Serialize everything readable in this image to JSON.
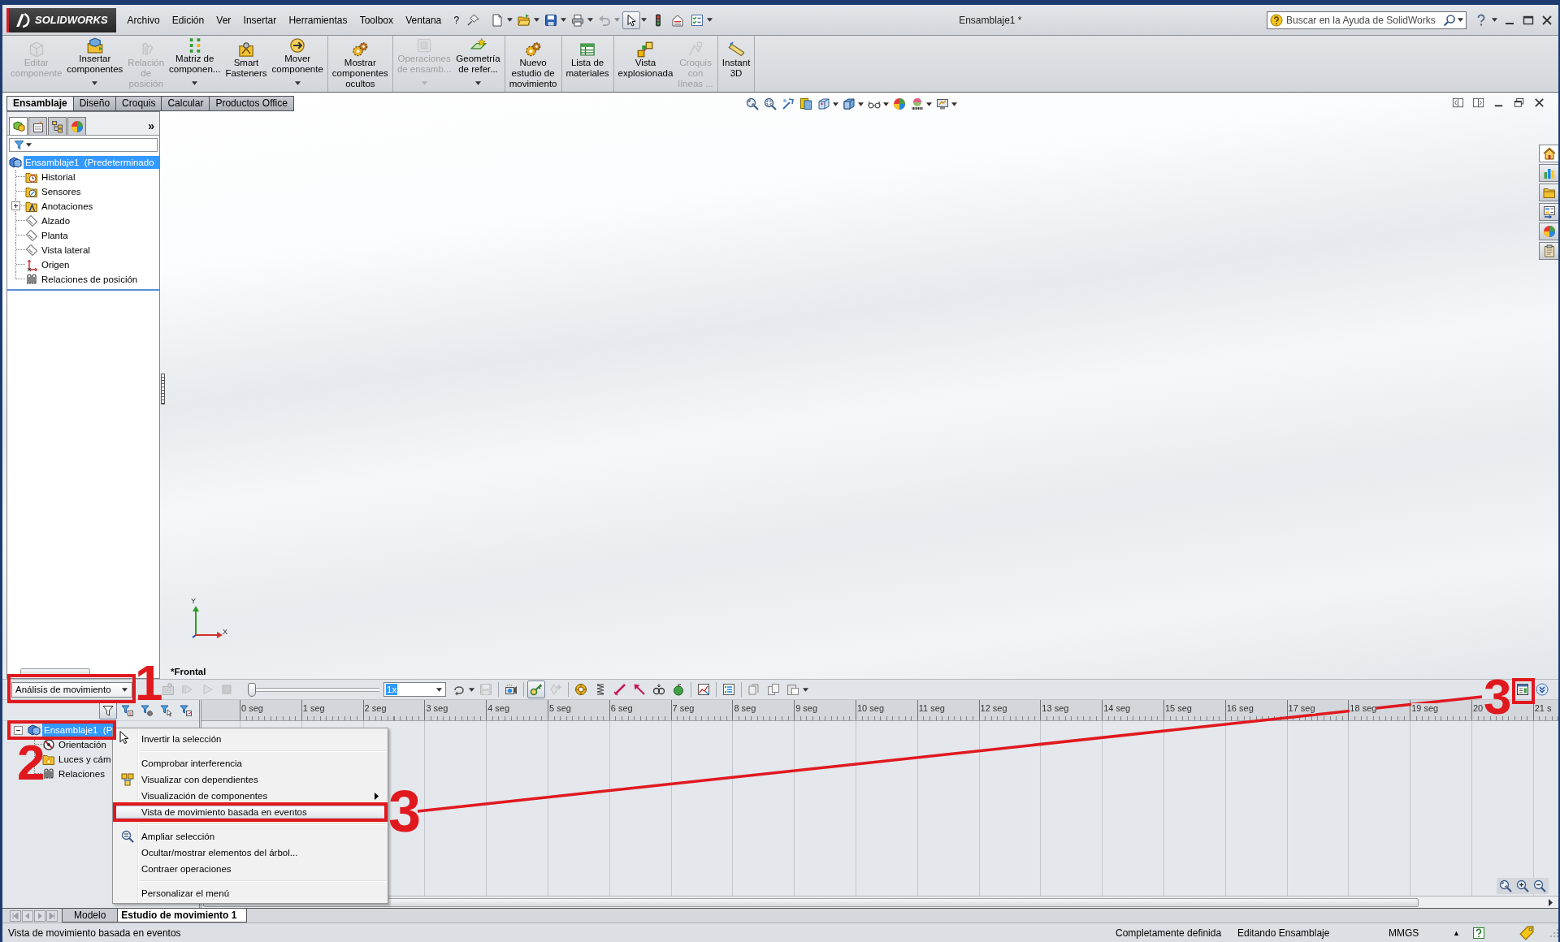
{
  "menubar": {
    "logo": "SOLIDWORKS",
    "menus": [
      "Archivo",
      "Edición",
      "Ver",
      "Insertar",
      "Herramientas",
      "Toolbox",
      "Ventana",
      "?"
    ],
    "quick_access": [
      {
        "disabled": false,
        "pressed": false
      },
      {
        "disabled": false,
        "pressed": false
      },
      {
        "disabled": false,
        "pressed": false
      },
      {
        "disabled": false,
        "pressed": false
      },
      {
        "disabled": true,
        "pressed": false
      },
      {
        "disabled": false,
        "pressed": true
      },
      {
        "disabled": false,
        "pressed": false
      },
      {
        "disabled": false,
        "pressed": false
      },
      {
        "disabled": false,
        "pressed": false
      }
    ],
    "title": "Ensamblaje1 *",
    "search": {
      "placeholder": "Buscar en la Ayuda de SolidWorks"
    }
  },
  "ribbon": {
    "groups": [
      [
        {
          "label": "Editar\ncomponente",
          "disabled": true,
          "dropdown": false
        },
        {
          "label": "Insertar\ncomponentes",
          "disabled": false,
          "dropdown": true
        },
        {
          "label": "Relación\nde\nposición",
          "disabled": true,
          "dropdown": false
        },
        {
          "label": "Matriz de\ncomponen...",
          "disabled": false,
          "dropdown": true
        },
        {
          "label": "Smart\nFasteners",
          "disabled": false,
          "dropdown": false
        },
        {
          "label": "Mover\ncomponente",
          "disabled": false,
          "dropdown": true
        }
      ],
      [
        {
          "label": "Mostrar\ncomponentes\nocultos",
          "disabled": false,
          "dropdown": false
        }
      ],
      [
        {
          "label": "Operaciones\nde ensamb...",
          "disabled": true,
          "dropdown": true
        },
        {
          "label": "Geometría\nde refer...",
          "disabled": false,
          "dropdown": true
        }
      ],
      [
        {
          "label": "Nuevo\nestudio de\nmovimiento",
          "disabled": false,
          "dropdown": false
        }
      ],
      [
        {
          "label": "Lista de\nmateriales",
          "disabled": false,
          "dropdown": false
        }
      ],
      [
        {
          "label": "Vista\nexplosionada",
          "disabled": false,
          "dropdown": false
        },
        {
          "label": "Croquis\ncon\nlíneas ...",
          "disabled": true,
          "dropdown": false
        }
      ],
      [
        {
          "label": "Instant\n3D",
          "disabled": false,
          "dropdown": false
        }
      ]
    ]
  },
  "command_tabs": [
    {
      "label": "Ensamblaje",
      "selected": true
    },
    {
      "label": "Diseño",
      "selected": false
    },
    {
      "label": "Croquis",
      "selected": false
    },
    {
      "label": "Calcular",
      "selected": false
    },
    {
      "label": "Productos Office",
      "selected": false
    }
  ],
  "feature_manager": {
    "tabs": [
      {
        "selected": true
      },
      {
        "selected": false
      },
      {
        "selected": false
      },
      {
        "selected": false
      }
    ],
    "more": "»",
    "tree": {
      "label": "Ensamblaje1  (Predeterminado",
      "selected": true,
      "children": [
        {
          "label": "Historial",
          "selected": false
        },
        {
          "label": "Sensores",
          "selected": false
        },
        {
          "label": "Anotaciones",
          "selected": false,
          "expanded": false
        },
        {
          "label": "Alzado",
          "selected": false
        },
        {
          "label": "Planta",
          "selected": false
        },
        {
          "label": "Vista lateral",
          "selected": false
        },
        {
          "label": "Origen",
          "selected": false
        },
        {
          "label": "Relaciones de posición",
          "selected": false
        }
      ]
    }
  },
  "viewport": {
    "view_name": "*Frontal",
    "triad": {
      "y_label": "Y",
      "x_label": "X"
    }
  },
  "task_pane": [
    {
      "selected": true
    },
    {
      "selected": false
    },
    {
      "selected": false
    },
    {
      "selected": false
    },
    {
      "selected": false
    },
    {
      "selected": false
    }
  ],
  "motion_study": {
    "study_type": "Análisis de movimiento",
    "toolbar": [
      {
        "disabled": true,
        "pressed": false
      },
      {
        "disabled": true,
        "pressed": false
      },
      {
        "disabled": true,
        "pressed": false
      },
      {
        "disabled": true,
        "pressed": false
      },
      {
        "disabled": false,
        "pressed": false
      },
      {
        "disabled": true,
        "pressed": false
      },
      {
        "disabled": false,
        "pressed": false
      },
      {
        "disabled": false,
        "pressed": true
      },
      {
        "disabled": true,
        "pressed": false
      },
      {
        "disabled": false,
        "pressed": false
      },
      {
        "disabled": false,
        "pressed": false
      },
      {
        "disabled": false,
        "pressed": false
      },
      {
        "disabled": false,
        "pressed": false
      },
      {
        "disabled": false,
        "pressed": false
      },
      {
        "disabled": false,
        "pressed": false
      },
      {
        "disabled": false,
        "pressed": false
      },
      {
        "disabled": false,
        "pressed": false
      },
      {
        "disabled": false,
        "pressed": false
      },
      {
        "disabled": false,
        "pressed": false
      },
      {
        "disabled": false,
        "pressed": false
      },
      {
        "disabled": false,
        "pressed": false
      },
      {
        "disabled": false,
        "pressed": false
      }
    ],
    "slider": {
      "level": 0
    },
    "speed": "1x",
    "tree_filters": [
      {
        "pressed": true
      },
      {
        "pressed": false
      },
      {
        "pressed": false
      },
      {
        "pressed": false
      },
      {
        "pressed": false
      }
    ],
    "tree": {
      "label": "Ensamblaje1  (P",
      "selected": true,
      "expanded": true,
      "children": [
        {
          "label": "Orientación",
          "selected": false
        },
        {
          "label": "Luces y cám",
          "selected": false
        },
        {
          "label": "Relaciones",
          "selected": false
        }
      ]
    },
    "timeline": [
      "0 seg",
      "1 seg",
      "2 seg",
      "3 seg",
      "4 seg",
      "5 seg",
      "6 seg",
      "7 seg",
      "8 seg",
      "9 seg",
      "10 seg",
      "11 seg",
      "12 seg",
      "13 seg",
      "14 seg",
      "15 seg",
      "16 seg",
      "17 seg",
      "18 seg",
      "19 seg",
      "20",
      "21 s"
    ]
  },
  "context_menu": [
    {
      "kind": "item",
      "label": "Invertir la selección",
      "selected": false,
      "submenu": false
    },
    {
      "kind": "separator"
    },
    {
      "kind": "item",
      "label": "Comprobar interferencia",
      "selected": false,
      "submenu": false
    },
    {
      "kind": "item",
      "label": "Visualizar con dependientes",
      "selected": false,
      "submenu": false
    },
    {
      "kind": "item",
      "label": "Visualización de componentes",
      "selected": false,
      "submenu": true
    },
    {
      "kind": "item",
      "label": "Vista de movimiento basada en eventos",
      "selected": true,
      "submenu": false
    },
    {
      "kind": "separator"
    },
    {
      "kind": "item",
      "label": "Ampliar selección",
      "selected": false,
      "submenu": false
    },
    {
      "kind": "item",
      "label": "Ocultar/mostrar elementos del árbol...",
      "selected": false,
      "submenu": false
    },
    {
      "kind": "item",
      "label": "Contraer operaciones",
      "selected": false,
      "submenu": false
    },
    {
      "kind": "separator"
    },
    {
      "kind": "item",
      "label": "Personalizar el menú",
      "selected": false,
      "submenu": false
    }
  ],
  "sheet_tabs": [
    {
      "label": "Modelo",
      "selected": false
    },
    {
      "label": "Estudio de movimiento 1",
      "selected": true
    }
  ],
  "status_bar": {
    "message": "Vista de movimiento basada en eventos",
    "fields": [
      "Completamente definida",
      "Editando Ensamblaje",
      "MMGS",
      "▲"
    ]
  },
  "annotations": [
    "1",
    "2",
    "3",
    "3"
  ]
}
